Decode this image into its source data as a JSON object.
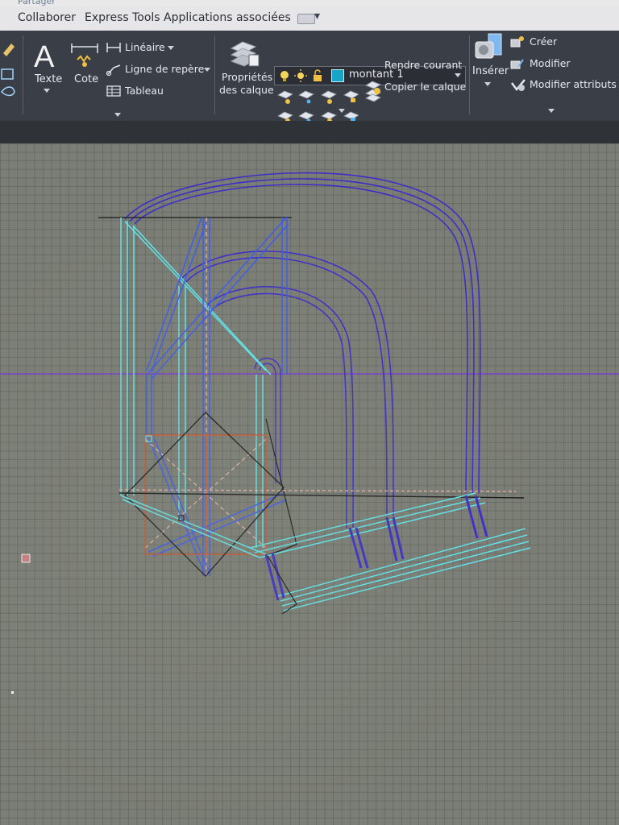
{
  "window": {
    "partial_title": "Partager"
  },
  "menu": {
    "items": [
      "Collaborer",
      "Express Tools",
      "Applications associées"
    ]
  },
  "ribbon": {
    "annotation": {
      "texte_label": "Texte",
      "cote_label": "Cote",
      "lineaire_label": "Linéaire",
      "ligne_repere_label": "Ligne de repère",
      "tableau_label": "Tableau"
    },
    "layers": {
      "proprietes_line1": "Propriétés",
      "proprietes_line2": "des calque",
      "current_layer": "montant 1",
      "layer_color": "#17a6c9",
      "rendre_courant": "Rendre courant",
      "copier_calque": "Copier le calque"
    },
    "block": {
      "inserer_label": "Insérer",
      "creer_label": "Créer",
      "modifier_label": "Modifier",
      "modifier_attributs_label": "Modifier attributs"
    }
  },
  "drawing": {
    "colors": {
      "cyan": "#5fe6ea",
      "blue": "#3a5bf0",
      "indigo": "#3d2ec8",
      "orange": "#d9532a",
      "pink": "#f0b8a8",
      "black": "#1a1a1a",
      "purple_axis": "#7a3fd0"
    }
  }
}
